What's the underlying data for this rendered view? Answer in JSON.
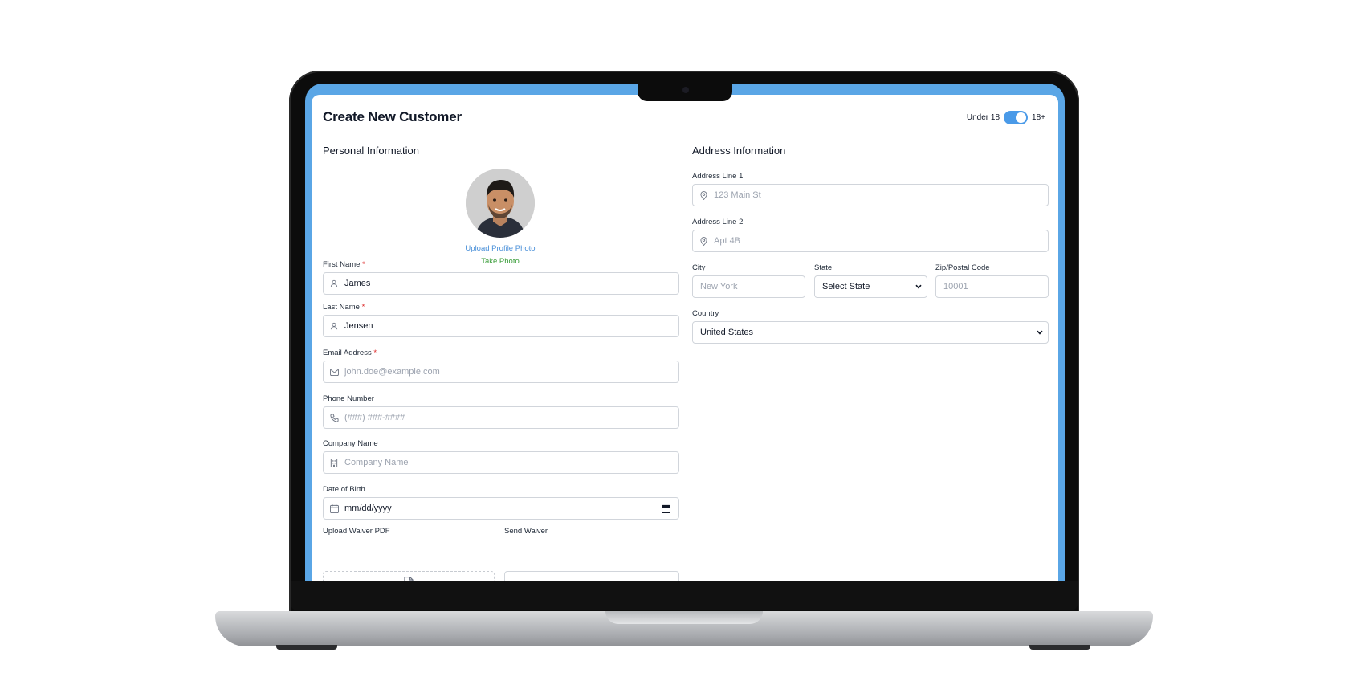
{
  "app": {
    "title": "Create New Customer",
    "accent": "#5aa6e6"
  },
  "age_toggle": {
    "left_label": "Under 18",
    "right_label": "18+",
    "state": "18+"
  },
  "personal": {
    "section_title": "Personal Information",
    "photo": {
      "upload_label": "Upload Profile Photo",
      "take_label": "Take Photo"
    },
    "first_name": {
      "label": "First Name",
      "required_mark": "*",
      "value": "James",
      "icon": "user-icon"
    },
    "last_name": {
      "label": "Last Name",
      "required_mark": "*",
      "value": "Jensen",
      "icon": "user-icon"
    },
    "email": {
      "label": "Email Address",
      "required_mark": "*",
      "placeholder": "john.doe@example.com",
      "icon": "mail-icon"
    },
    "phone": {
      "label": "Phone Number",
      "placeholder": "(###) ###-####",
      "icon": "phone-icon"
    },
    "company": {
      "label": "Company Name",
      "placeholder": "Company Name",
      "icon": "building-icon"
    },
    "dob": {
      "label": "Date of Birth",
      "placeholder": "mm/dd/yyyy",
      "icon": "calendar-icon"
    },
    "waiver_upload": {
      "label": "Upload Waiver PDF",
      "icon": "file-icon"
    },
    "send_waiver": {
      "label": "Send Waiver"
    }
  },
  "address": {
    "section_title": "Address Information",
    "line1": {
      "label": "Address Line 1",
      "placeholder": "123 Main St",
      "icon": "location-pin-icon"
    },
    "line2": {
      "label": "Address Line 2",
      "placeholder": "Apt 4B",
      "icon": "location-pin-icon"
    },
    "city": {
      "label": "City",
      "placeholder": "New York"
    },
    "state": {
      "label": "State",
      "value": "Select State"
    },
    "zip": {
      "label": "Zip/Postal Code",
      "placeholder": "10001"
    },
    "country": {
      "label": "Country",
      "value": "United States"
    }
  }
}
